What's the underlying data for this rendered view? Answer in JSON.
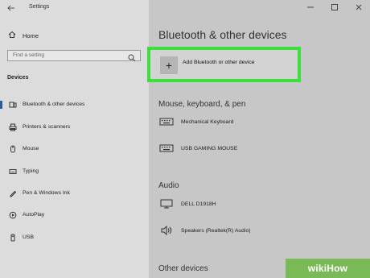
{
  "window": {
    "title": "Settings"
  },
  "sidebar": {
    "home_label": "Home",
    "search_placeholder": "Find a setting",
    "section_title": "Devices",
    "items": [
      {
        "label": "Bluetooth & other devices",
        "icon": "bluetooth-icon",
        "active": true
      },
      {
        "label": "Printers & scanners",
        "icon": "printer-icon",
        "active": false
      },
      {
        "label": "Mouse",
        "icon": "mouse-icon",
        "active": false
      },
      {
        "label": "Typing",
        "icon": "keyboard-icon",
        "active": false
      },
      {
        "label": "Pen & Windows Ink",
        "icon": "pen-icon",
        "active": false
      },
      {
        "label": "AutoPlay",
        "icon": "autoplay-icon",
        "active": false
      },
      {
        "label": "USB",
        "icon": "usb-icon",
        "active": false
      }
    ]
  },
  "main": {
    "title": "Bluetooth & other devices",
    "add_button_label": "Add Bluetooth or other device",
    "sections": {
      "mouse_keyboard_pen": {
        "title": "Mouse, keyboard, & pen",
        "devices": [
          {
            "name": "Mechanical Keyboard",
            "icon": "keyboard-icon"
          },
          {
            "name": "USB GAMING MOUSE",
            "icon": "keyboard-icon"
          }
        ]
      },
      "audio": {
        "title": "Audio",
        "devices": [
          {
            "name": "DELL D1918H",
            "icon": "monitor-icon"
          },
          {
            "name": "Speakers (Realtek(R) Audio)",
            "icon": "speaker-icon"
          }
        ]
      },
      "other": {
        "title": "Other devices"
      }
    }
  },
  "watermark": {
    "text": "wikiHow"
  },
  "colors": {
    "highlight_border": "#3ddf3d",
    "active_accent": "#2a5d9b",
    "watermark_bg": "#79b956"
  }
}
